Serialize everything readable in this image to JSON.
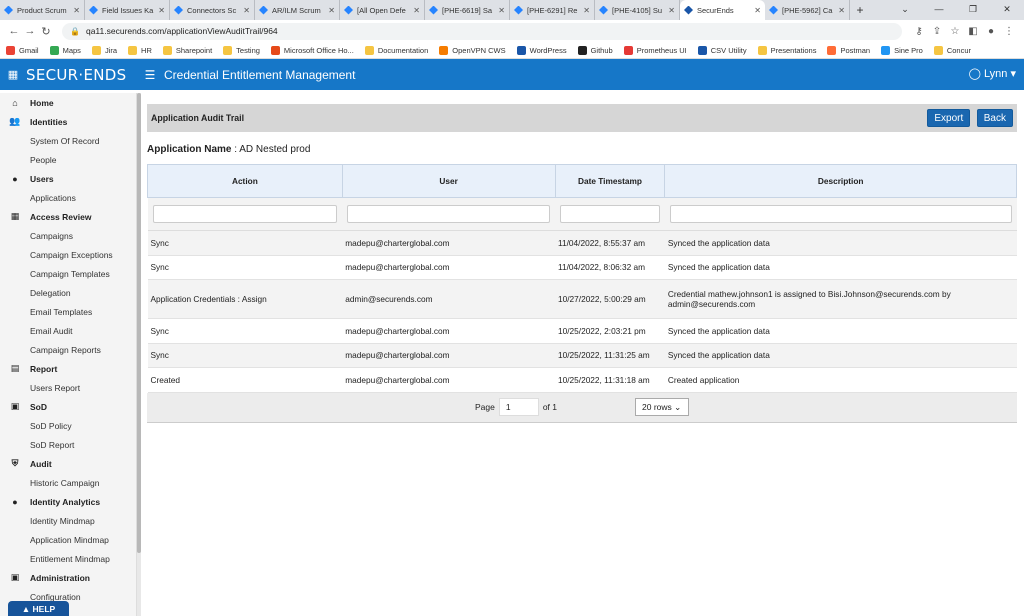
{
  "browser": {
    "tabs": [
      {
        "title": "Product Scrum",
        "color": "#2684ff"
      },
      {
        "title": "Field Issues Ka",
        "color": "#2684ff"
      },
      {
        "title": "Connectors Sc",
        "color": "#2684ff"
      },
      {
        "title": "AR/ILM Scrum",
        "color": "#2684ff"
      },
      {
        "title": "[All Open Defe",
        "color": "#2684ff"
      },
      {
        "title": "[PHE-6619] Sa",
        "color": "#2684ff"
      },
      {
        "title": "[PHE-6291] Re",
        "color": "#2684ff"
      },
      {
        "title": "[PHE-4105] Su",
        "color": "#2684ff"
      },
      {
        "title": "SecurEnds",
        "color": "#1a56a8"
      },
      {
        "title": "[PHE-5962] Ca",
        "color": "#2684ff"
      }
    ],
    "new_tab": "+",
    "url": "qa11.securends.com/applicationViewAuditTrail/964",
    "bookmarks": [
      {
        "label": "Gmail",
        "color": "#ea4335"
      },
      {
        "label": "Maps",
        "color": "#34a853"
      },
      {
        "label": "Jira",
        "color": "#f5c542"
      },
      {
        "label": "HR",
        "color": "#f5c542"
      },
      {
        "label": "Sharepoint",
        "color": "#f5c542"
      },
      {
        "label": "Testing",
        "color": "#f5c542"
      },
      {
        "label": "Microsoft Office Ho...",
        "color": "#e64a19"
      },
      {
        "label": "Documentation",
        "color": "#f5c542"
      },
      {
        "label": "OpenVPN CWS",
        "color": "#f57c00"
      },
      {
        "label": "WordPress",
        "color": "#1a56a8"
      },
      {
        "label": "Github",
        "color": "#222222"
      },
      {
        "label": "Prometheus UI",
        "color": "#e53935"
      },
      {
        "label": "CSV Utility",
        "color": "#1a56a8"
      },
      {
        "label": "Presentations",
        "color": "#f5c542"
      },
      {
        "label": "Postman",
        "color": "#ff6c37"
      },
      {
        "label": "Sine Pro",
        "color": "#2196f3"
      },
      {
        "label": "Concur",
        "color": "#f5c542"
      }
    ]
  },
  "app": {
    "logo": "SECUR·ENDS",
    "title": "Credential Entitlement Management",
    "user": "Lynn",
    "brand_color": "#1677c8"
  },
  "sidebar": [
    {
      "type": "sec",
      "label": "Home",
      "icon": "home-icon",
      "glyph": "⌂"
    },
    {
      "type": "sec",
      "label": "Identities",
      "icon": "users-icon",
      "glyph": "👥"
    },
    {
      "type": "sub",
      "label": "System Of Record"
    },
    {
      "type": "sub",
      "label": "People"
    },
    {
      "type": "sec",
      "label": "Users",
      "icon": "user-icon",
      "glyph": "●"
    },
    {
      "type": "sub",
      "label": "Applications"
    },
    {
      "type": "sec",
      "label": "Access Review",
      "icon": "grid-icon",
      "glyph": "▦"
    },
    {
      "type": "sub",
      "label": "Campaigns"
    },
    {
      "type": "sub",
      "label": "Campaign Exceptions"
    },
    {
      "type": "sub",
      "label": "Campaign Templates"
    },
    {
      "type": "sub",
      "label": "Delegation"
    },
    {
      "type": "sub",
      "label": "Email Templates"
    },
    {
      "type": "sub",
      "label": "Email Audit"
    },
    {
      "type": "sub",
      "label": "Campaign Reports"
    },
    {
      "type": "sec",
      "label": "Report",
      "icon": "file-icon",
      "glyph": "▤"
    },
    {
      "type": "sub",
      "label": "Users Report"
    },
    {
      "type": "sec",
      "label": "SoD",
      "icon": "list-icon",
      "glyph": "▣"
    },
    {
      "type": "sub",
      "label": "SoD Policy"
    },
    {
      "type": "sub",
      "label": "SoD Report"
    },
    {
      "type": "sec",
      "label": "Audit",
      "icon": "shield-icon",
      "glyph": "⛨"
    },
    {
      "type": "sub",
      "label": "Historic Campaign"
    },
    {
      "type": "sec",
      "label": "Identity Analytics",
      "icon": "circle-icon",
      "glyph": "●"
    },
    {
      "type": "sub",
      "label": "Identity Mindmap"
    },
    {
      "type": "sub",
      "label": "Application Mindmap"
    },
    {
      "type": "sub",
      "label": "Entitlement Mindmap"
    },
    {
      "type": "sec",
      "label": "Administration",
      "icon": "settings-icon",
      "glyph": "▣"
    },
    {
      "type": "sub",
      "label": "Configuration"
    }
  ],
  "help": "HELP",
  "panel": {
    "title": "Application Audit Trail",
    "export": "Export",
    "back": "Back",
    "app_name_label": "Application Name",
    "app_name_value": ": AD Nested prod"
  },
  "table": {
    "columns": [
      "Action",
      "User",
      "Date Timestamp",
      "Description"
    ],
    "rows": [
      [
        "Sync",
        "madepu@charterglobal.com",
        "11/04/2022, 8:55:37 am",
        "Synced the application data"
      ],
      [
        "Sync",
        "madepu@charterglobal.com",
        "11/04/2022, 8:06:32 am",
        "Synced the application data"
      ],
      [
        "Application Credentials : Assign",
        "admin@securends.com",
        "10/27/2022, 5:00:29 am",
        "Credential mathew.johnson1 is assigned to Bisi.Johnson@securends.com by admin@securends.com"
      ],
      [
        "Sync",
        "madepu@charterglobal.com",
        "10/25/2022, 2:03:21 pm",
        "Synced the application data"
      ],
      [
        "Sync",
        "madepu@charterglobal.com",
        "10/25/2022, 11:31:25 am",
        "Synced the application data"
      ],
      [
        "Created",
        "madepu@charterglobal.com",
        "10/25/2022, 11:31:18 am",
        "Created application"
      ]
    ]
  },
  "pager": {
    "page_label": "Page",
    "page_value": "1",
    "of_label": "of 1",
    "rows_value": "20 rows"
  }
}
